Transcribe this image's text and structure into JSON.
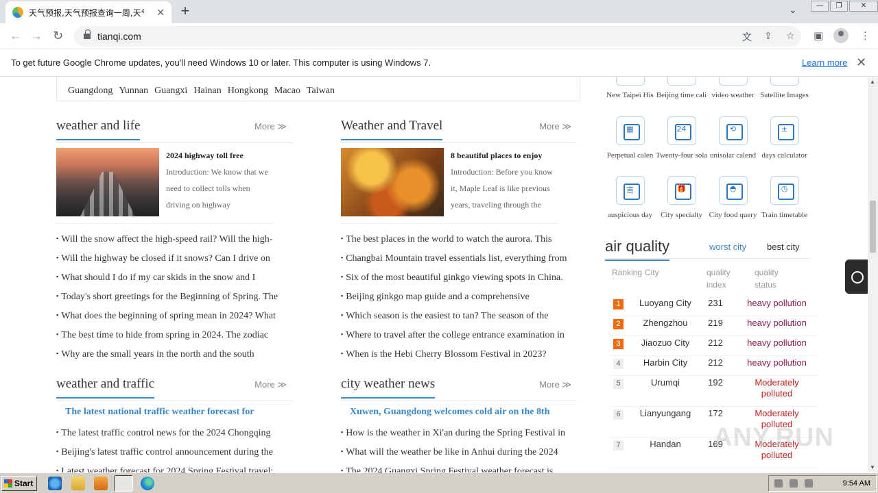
{
  "browser": {
    "tab_title": "天气预报,天气预报查询一周,天气预",
    "tab_close": "✕",
    "new_tab": "+",
    "url": "tianqi.com",
    "window_controls": {
      "minimize": "—",
      "restore": "❐",
      "close": "✕"
    }
  },
  "infobar": {
    "message": "To get future Google Chrome updates, you'll need Windows 10 or later. This computer is using Windows 7.",
    "learn_more": "Learn more",
    "close": "✕"
  },
  "regions": [
    "Guangdong",
    "Yunnan",
    "Guangxi",
    "Hainan",
    "Hongkong",
    "Macao",
    "Taiwan"
  ],
  "more_label": "More ≫",
  "sections": {
    "weather_life": {
      "title": "weather and life",
      "feature": {
        "title": "2024 highway toll free",
        "intro": "Introduction: We know that we need to collect tolls when driving on highway"
      },
      "items": [
        "Will the snow affect the high-speed rail? Will the high-",
        "Will the highway be closed if it snows? Can I drive on",
        "What should I do if my car skids in the snow and I",
        "Today's short greetings for the Beginning of Spring. The",
        "What does the beginning of spring mean in 2024? What",
        "The best time to hide from spring in 2024. The zodiac",
        "Why are the small years in the north and the south"
      ]
    },
    "weather_travel": {
      "title": "Weather and Travel",
      "feature": {
        "title": "8 beautiful places to enjoy",
        "intro": "Introduction: Before you know it, Maple Leaf is like previous years, traveling through the"
      },
      "items": [
        "The best places in the world to watch the aurora. This",
        "Changbai Mountain travel essentials list, everything from",
        "Six of the most beautiful ginkgo viewing spots in China.",
        "Beijing ginkgo map guide and a comprehensive",
        "Which season is the easiest to tan? The season of the",
        "Where to travel after the college entrance examination in",
        "When is the Hebi Cherry Blossom Festival in 2023?"
      ]
    },
    "weather_traffic": {
      "title": "weather and traffic",
      "headline": "The latest national traffic weather forecast for",
      "items": [
        "The latest traffic control news for the 2024 Chongqing",
        "Beijing's latest traffic control announcement during the",
        "Latest weather forecast for 2024 Spring Festival travel:"
      ]
    },
    "city_news": {
      "title": "city weather news",
      "headline": "Xuwen, Guangdong welcomes cold air on the 8th",
      "items": [
        "How is the weather in Xi'an during the Spring Festival in",
        "What will the weather be like in Anhui during the 2024",
        "The 2024 Guangxi Spring Festival weather forecast is"
      ]
    }
  },
  "tools_top": [
    "New Taipei His",
    "Beijing time cali",
    "video weather",
    "Satellite Images"
  ],
  "tools": [
    {
      "label": "Perpetual calen",
      "glyph": "▦",
      "icon": "calendar-grid-icon"
    },
    {
      "label": "Twenty-four solar",
      "glyph": "24",
      "icon": "solar-terms-icon"
    },
    {
      "label": "unisolar calend",
      "glyph": "⟲",
      "icon": "lunar-calendar-icon"
    },
    {
      "label": "days calculator",
      "glyph": "±",
      "icon": "calculator-icon"
    },
    {
      "label": "auspicious day",
      "glyph": "吉",
      "icon": "auspicious-icon"
    },
    {
      "label": "City specialty",
      "glyph": "🎁",
      "icon": "gift-icon"
    },
    {
      "label": "City food query",
      "glyph": "◓",
      "icon": "food-cloche-icon"
    },
    {
      "label": "Train timetable",
      "glyph": "◷",
      "icon": "timetable-icon"
    }
  ],
  "air_quality": {
    "title": "air quality",
    "tabs": [
      "worst city",
      "best city"
    ],
    "headers": {
      "ranking": "Ranking",
      "city": "City",
      "index": "quality index",
      "status": "quality status"
    },
    "rows": [
      {
        "rank": "1",
        "city": "Luoyang City",
        "index": "231",
        "status": "heavy pollution",
        "level": "heavy"
      },
      {
        "rank": "2",
        "city": "Zhengzhou",
        "index": "219",
        "status": "heavy pollution",
        "level": "heavy"
      },
      {
        "rank": "3",
        "city": "Jiaozuo City",
        "index": "212",
        "status": "heavy pollution",
        "level": "heavy"
      },
      {
        "rank": "4",
        "city": "Harbin City",
        "index": "212",
        "status": "heavy pollution",
        "level": "heavy"
      },
      {
        "rank": "5",
        "city": "Urumqi",
        "index": "192",
        "status": "Moderately polluted",
        "level": "moderate"
      },
      {
        "rank": "6",
        "city": "Lianyungang",
        "index": "172",
        "status": "Moderately polluted",
        "level": "moderate"
      },
      {
        "rank": "7",
        "city": "Handan",
        "index": "169",
        "status": "Moderately polluted",
        "level": "moderate"
      }
    ]
  },
  "watermark": "ANY.RUN",
  "taskbar": {
    "start": "Start",
    "clock": "9:54 AM"
  }
}
